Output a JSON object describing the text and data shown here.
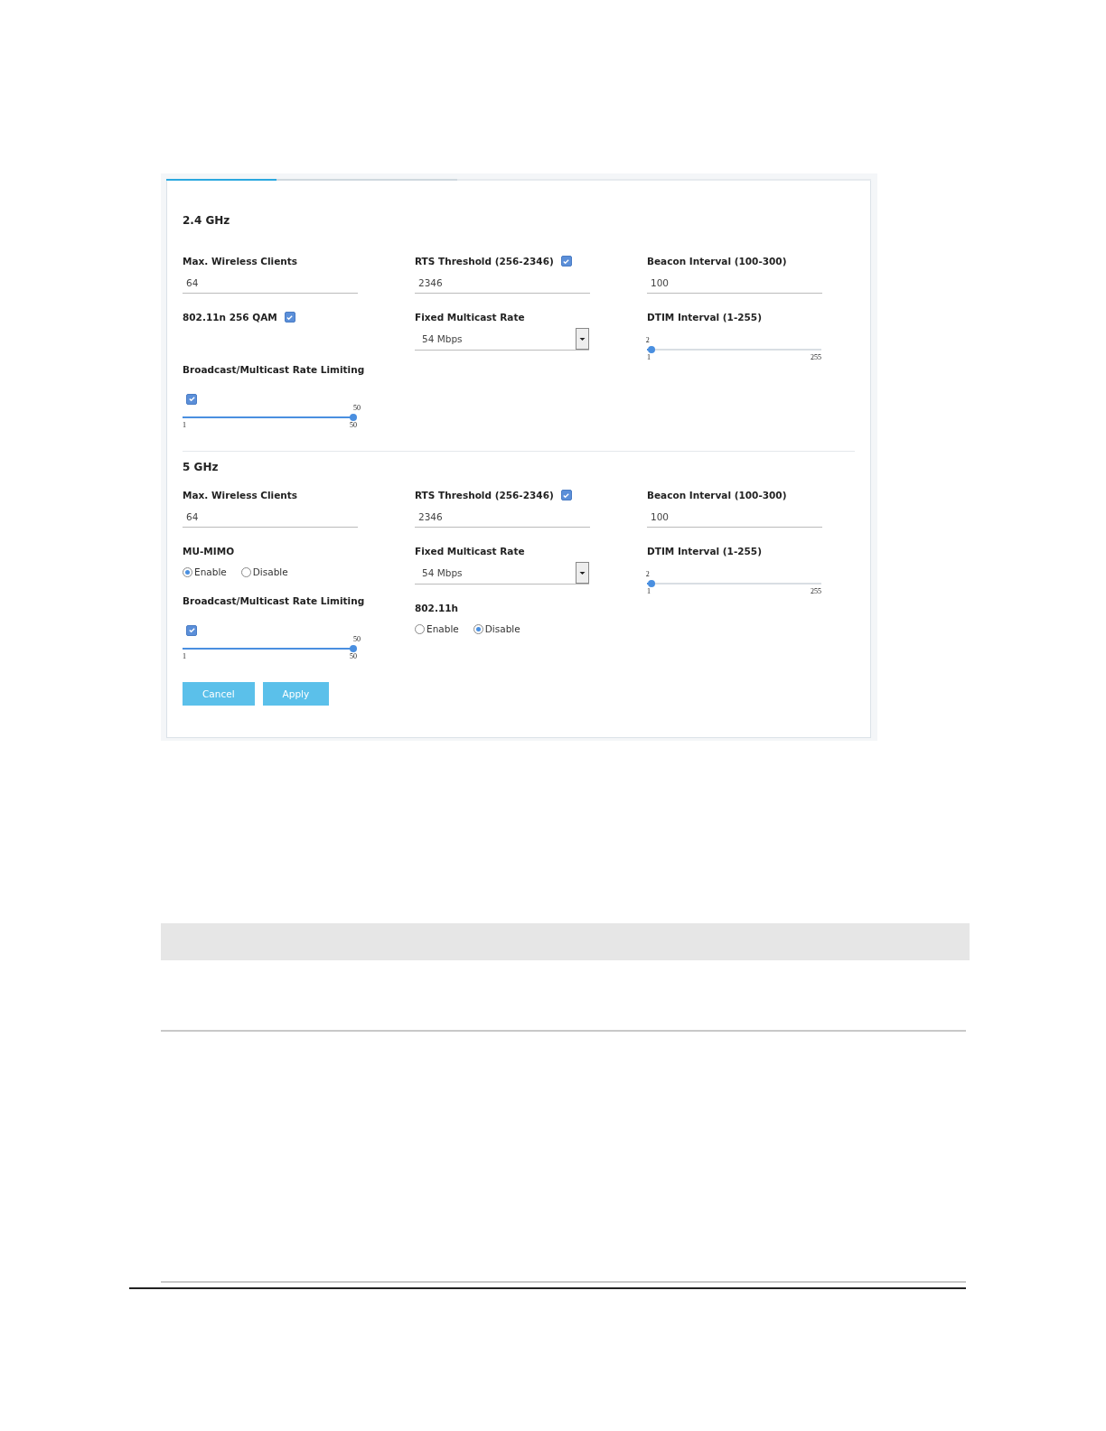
{
  "tabs": [
    {
      "selected": true
    },
    {
      "selected": false
    }
  ],
  "sections": [
    {
      "title": "2.4 GHz",
      "columns": [
        [
          {
            "kind": "input",
            "label": "Max. Wireless Clients",
            "value": "64"
          },
          {
            "kind": "check",
            "label": "802.11n 256 QAM",
            "checked": true
          },
          {
            "kind": "slider",
            "label": "Broadcast/Multicast Rate Limiting",
            "checked": true,
            "level": 1,
            "value": "50",
            "min": "1",
            "max": "50"
          }
        ],
        [
          {
            "kind": "input",
            "label": "RTS Threshold (256-2346)",
            "checked": true,
            "value": "2346"
          },
          {
            "kind": "select",
            "label": "Fixed Multicast Rate",
            "value": "54 Mbps"
          }
        ],
        [
          {
            "kind": "input",
            "label": "Beacon Interval (100-300)",
            "value": "100"
          },
          {
            "kind": "slider",
            "label": "DTIM Interval (1-255)",
            "level": 0.004,
            "value": "2",
            "min": "1",
            "max": "255"
          }
        ]
      ]
    },
    {
      "title": "5 GHz",
      "columns": [
        [
          {
            "kind": "input",
            "label": "Max. Wireless Clients",
            "value": "64"
          },
          {
            "kind": "radio",
            "label": "MU-MIMO",
            "options": [
              {
                "label": "Enable",
                "selected": true
              },
              {
                "label": "Disable",
                "selected": false
              }
            ]
          },
          {
            "kind": "slider",
            "label": "Broadcast/Multicast Rate Limiting",
            "checked": true,
            "level": 1,
            "value": "50",
            "min": "1",
            "max": "50"
          }
        ],
        [
          {
            "kind": "input",
            "label": "RTS Threshold (256-2346)",
            "checked": true,
            "value": "2346"
          },
          {
            "kind": "select",
            "label": "Fixed Multicast Rate",
            "value": "54 Mbps"
          },
          {
            "kind": "radio",
            "label": "802.11h",
            "options": [
              {
                "label": "Enable",
                "selected": false
              },
              {
                "label": "Disable",
                "selected": true
              }
            ]
          }
        ],
        [
          {
            "kind": "input",
            "label": "Beacon Interval (100-300)",
            "value": "100"
          },
          {
            "kind": "slider",
            "label": "DTIM Interval (1-255)",
            "level": 0.004,
            "value": "2",
            "min": "1",
            "max": "255"
          }
        ]
      ]
    }
  ],
  "buttons": [
    "Cancel",
    "Apply"
  ]
}
